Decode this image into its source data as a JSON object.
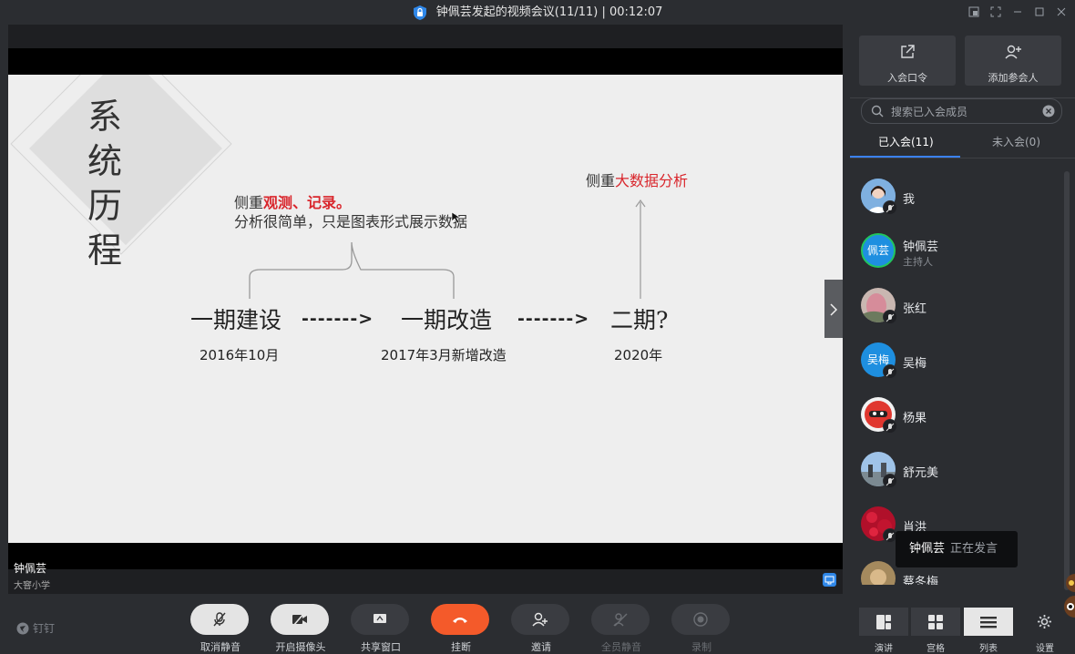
{
  "window": {
    "title": "钟佩芸发起的视频会议(11/11) | 00:12:07"
  },
  "slide": {
    "title_chars": [
      "系",
      "统",
      "历",
      "程"
    ],
    "note1_prefix": "侧重",
    "note1_highlight": "观测、记录。",
    "note1_line2": "分析很简单，只是图表形式展示数据",
    "note2_prefix": "侧重",
    "note2_highlight": "大数据分析",
    "phases": [
      "一期建设",
      "一期改造",
      "二期?"
    ],
    "arrows": [
      "------->",
      "------->"
    ],
    "dates": [
      "2016年10月",
      "2017年3月新增改造",
      "2020年"
    ]
  },
  "speaker": {
    "name": "钟佩芸",
    "org": "大窨小学"
  },
  "toolbar": {
    "brand": "钉钉",
    "buttons": [
      {
        "label": "取消静音"
      },
      {
        "label": "开启摄像头"
      },
      {
        "label": "共享窗口"
      },
      {
        "label": "挂断"
      },
      {
        "label": "邀请"
      },
      {
        "label": "全员静音"
      },
      {
        "label": "录制"
      }
    ]
  },
  "panel": {
    "join_code_label": "入会口令",
    "add_participant_label": "添加参会人",
    "search_placeholder": "搜索已入会成员",
    "tab_joined": "已入会(11)",
    "tab_not_joined": "未入会(0)",
    "members": [
      {
        "name": "我",
        "role": ""
      },
      {
        "name": "钟佩芸",
        "role": "主持人",
        "avatar_text": "佩芸"
      },
      {
        "name": "张红",
        "role": ""
      },
      {
        "name": "吴梅",
        "role": "",
        "avatar_text": "吴梅"
      },
      {
        "name": "杨果",
        "role": ""
      },
      {
        "name": "舒元美",
        "role": ""
      },
      {
        "name": "肖洪",
        "role": ""
      },
      {
        "name": "蔡冬梅",
        "role": ""
      }
    ],
    "speaking_tooltip": {
      "name": "钟佩芸",
      "status": "正在发言"
    },
    "views": [
      {
        "label": "演讲"
      },
      {
        "label": "宫格"
      },
      {
        "label": "列表"
      }
    ],
    "settings_label": "设置"
  },
  "colors": {
    "accent": "#3b82f6",
    "hangup": "#f45a2a",
    "highlight_red": "#d9262c"
  }
}
